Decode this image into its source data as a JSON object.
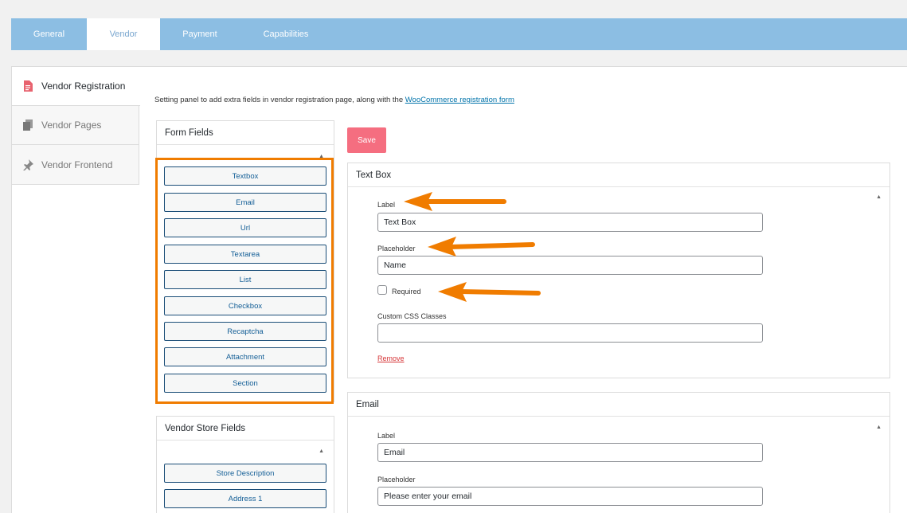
{
  "tabs": [
    {
      "label": "General"
    },
    {
      "label": "Vendor"
    },
    {
      "label": "Payment"
    },
    {
      "label": "Capabilities"
    }
  ],
  "sidebar": {
    "items": [
      {
        "label": "Vendor Registration",
        "icon": "document-icon"
      },
      {
        "label": "Vendor Pages",
        "icon": "pages-icon"
      },
      {
        "label": "Vendor Frontend",
        "icon": "pin-icon"
      }
    ]
  },
  "description": {
    "text": "Setting panel to add extra fields in vendor registration page, along with the ",
    "link": "WooCommerce registration form"
  },
  "form_fields": {
    "title": "Form Fields",
    "buttons": [
      "Textbox",
      "Email",
      "Url",
      "Textarea",
      "List",
      "Checkbox",
      "Recaptcha",
      "Attachment",
      "Section"
    ]
  },
  "store_fields": {
    "title": "Vendor Store Fields",
    "buttons": [
      "Store Description",
      "Address 1"
    ]
  },
  "save_label": "Save",
  "textbox_panel": {
    "title": "Text Box",
    "label_caption": "Label",
    "label_value": "Text Box",
    "placeholder_caption": "Placeholder",
    "placeholder_value": "Name",
    "required_label": "Required",
    "required_checked": false,
    "css_caption": "Custom CSS Classes",
    "css_value": "",
    "remove_label": "Remove"
  },
  "email_panel": {
    "title": "Email",
    "label_caption": "Label",
    "label_value": "Email",
    "placeholder_caption": "Placeholder",
    "placeholder_value": "Please enter your email"
  },
  "colors": {
    "tabbar": "#8cbee3",
    "save_button": "#f56e80",
    "annotation": "#f07c00",
    "link": "#0073aa"
  }
}
